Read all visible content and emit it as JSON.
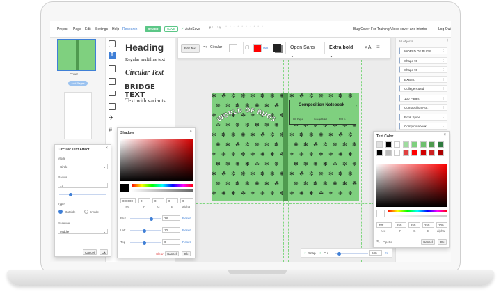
{
  "menu": {
    "items": [
      "Project",
      "Page",
      "Edit",
      "Settings",
      "Help"
    ],
    "research": "Research",
    "saved_label": "SAVED",
    "save_label": "SAVE",
    "autosave_label": "AutoSave",
    "doc_title": "Bug Cover For Training Video cover and interior",
    "logout": "Log Out"
  },
  "pages": {
    "cover_label": "Cover",
    "add_pages": "Add Pages",
    "page1_label": "Page 1"
  },
  "text_panel": {
    "heading": "Heading",
    "regular": "Regular multiline text",
    "circular": "Circular Text",
    "bridge": "BRIDGE TEXT",
    "variants": "Text with variants"
  },
  "toolbar": {
    "edit_text": "Edit Text",
    "circular": "Circular",
    "stroke_size": "0px",
    "font": "Open Sans",
    "weight": "Extra bold",
    "case_label": "aA"
  },
  "layers": {
    "count": "10 objects",
    "items": [
      "WORLD OF BUGS",
      "Shape 90",
      "Shape 90",
      "BXB In.",
      "College Ruled",
      "100 Pages",
      "Composition No..",
      "Book Spine",
      "Comp notebook"
    ]
  },
  "circ_dialog": {
    "title": "Circular Text Effect",
    "mode_label": "Mode",
    "mode_value": "Circle",
    "radius_label": "Radius",
    "radius_value": "17",
    "type_label": "Type",
    "outside": "Outside",
    "inside": "Inside",
    "baseline_label": "Baseline",
    "baseline_value": "Middle",
    "cancel": "Cancel",
    "ok": "Ok"
  },
  "shadow_dialog": {
    "title": "Shadow",
    "hex": "000000",
    "r": "0",
    "g": "0",
    "b": "0",
    "alpha": "0",
    "hex_l": "hex",
    "r_l": "R",
    "g_l": "G",
    "b_l": "B",
    "alpha_l": "alpha",
    "blur_label": "Blur",
    "blur_value": "28",
    "left_label": "Left",
    "left_value": "10",
    "top_label": "Top",
    "top_value": "0",
    "reset": "Reset",
    "clear": "Clear",
    "cancel": "Cancel",
    "ok": "Ok"
  },
  "textcolor_dialog": {
    "title": "Text Color",
    "hex": "ffffff",
    "r": "255",
    "g": "255",
    "b": "255",
    "alpha": "100",
    "hex_l": "hex",
    "r_l": "R",
    "g_l": "G",
    "b_l": "B",
    "alpha_l": "alpha",
    "pipette": "Pipette",
    "cancel": "Cancel",
    "ok": "Ok"
  },
  "cover": {
    "title": "WORLD OF BUGS",
    "notebook": "Composition Notebook",
    "lines_left": "100 Pages",
    "lines_mid": "College Ruled",
    "lines_right": "BXB In."
  },
  "bottombar": {
    "snap": "Snap",
    "cut": "Cut",
    "zoom": "100",
    "fit": "Fit"
  },
  "colors": {
    "accent": "#5cc787",
    "cover": "#7fd07f",
    "red": "#ff0000"
  }
}
